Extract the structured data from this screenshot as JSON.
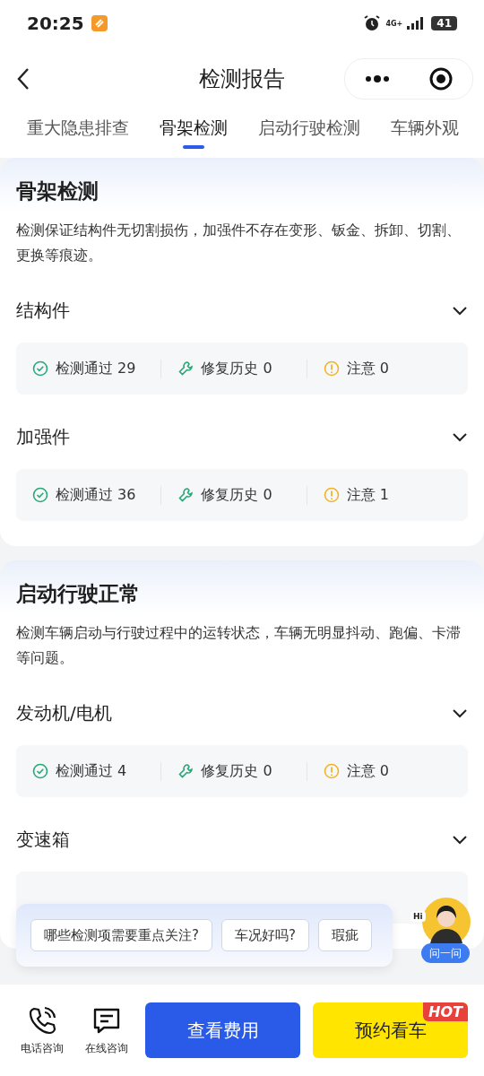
{
  "status_bar": {
    "time": "20:25",
    "network": "4G+",
    "battery": "41"
  },
  "nav": {
    "title": "检测报告"
  },
  "tabs": [
    {
      "label": "重大隐患排查",
      "selected": false
    },
    {
      "label": "骨架检测",
      "selected": true
    },
    {
      "label": "启动行驶检测",
      "selected": false
    },
    {
      "label": "车辆外观",
      "selected": false
    }
  ],
  "sections": [
    {
      "title": "骨架检测",
      "description": "检测保证结构件无切割损伤，加强件不存在变形、钣金、拆卸、切割、更换等痕迹。",
      "groups": [
        {
          "kind": "stats",
          "title": "结构件",
          "expanded": false,
          "stats": [
            {
              "kind": "pass",
              "label": "检测通过 29"
            },
            {
              "kind": "repair",
              "label": "修复历史 0"
            },
            {
              "kind": "warn",
              "label": "注意 0"
            }
          ]
        },
        {
          "kind": "stats",
          "title": "加强件",
          "expanded": false,
          "stats": [
            {
              "kind": "pass",
              "label": "检测通过 36"
            },
            {
              "kind": "repair",
              "label": "修复历史 0"
            },
            {
              "kind": "warn",
              "label": "注意 1"
            }
          ]
        }
      ]
    },
    {
      "title": "启动行驶正常",
      "description": "检测车辆启动与行驶过程中的运转状态，车辆无明显抖动、跑偏、卡滞等问题。",
      "groups": [
        {
          "kind": "stats",
          "title": "发动机/电机",
          "expanded": false,
          "stats": [
            {
              "kind": "pass",
              "label": "检测通过 4"
            },
            {
              "kind": "repair",
              "label": "修复历史 0"
            },
            {
              "kind": "warn",
              "label": "注意 0"
            }
          ]
        },
        {
          "kind": "covered",
          "title": "变速箱",
          "expanded": false
        }
      ]
    }
  ],
  "assistant": {
    "suggestions": [
      "哪些检测项需要重点关注?",
      "车况好吗?",
      "瑕疵"
    ],
    "greeting": "Hi",
    "button": "问一问"
  },
  "bottom_bar": {
    "actions": [
      {
        "kind": "phone",
        "label": "电话咨询"
      },
      {
        "kind": "chat",
        "label": "在线咨询"
      }
    ],
    "buttons": [
      {
        "kind": "primary",
        "label": "查看费用"
      },
      {
        "kind": "highlight",
        "label": "预约看车",
        "badge": "HOT"
      }
    ]
  }
}
